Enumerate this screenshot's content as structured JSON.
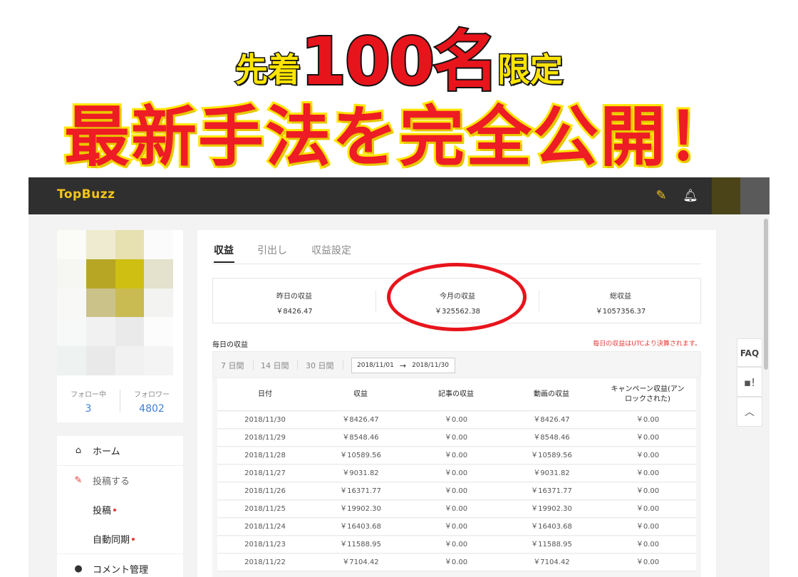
{
  "banner": {
    "line1_pre": "先着",
    "line1_big": "100名",
    "line1_post": "限定",
    "line2": "最新手法を完全公開！"
  },
  "app": {
    "logo": "TopBuzz",
    "icons": {
      "edit": "pencil-icon",
      "notifications": "bell-icon"
    }
  },
  "profile": {
    "following_label": "フォロー中",
    "following_count": "3",
    "followers_label": "フォロワー",
    "followers_count": "4802"
  },
  "nav": {
    "home": "ホーム",
    "post": "投稿する",
    "posts": "投稿",
    "auto_sync": "自動同期",
    "comments": "コメント管理"
  },
  "tabs": [
    "収益",
    "引出し",
    "収益設定"
  ],
  "summary": {
    "yesterday_label": "昨日の収益",
    "yesterday_value": "￥8426.47",
    "month_label": "今月の収益",
    "month_value": "￥325562.38",
    "total_label": "総収益",
    "total_value": "￥1057356.37"
  },
  "daily": {
    "title": "毎日の収益",
    "note": "毎日の収益はUTCより決算されます。",
    "filters": [
      "7 日間",
      "14 日間",
      "30 日間"
    ],
    "date_from": "2018/11/01",
    "date_to": "2018/11/30",
    "columns": [
      "日付",
      "収益",
      "記事の収益",
      "動画の収益",
      "キャンペーン収益(アンロックされた)"
    ],
    "rows": [
      [
        "2018/11/30",
        "￥8426.47",
        "￥0.00",
        "￥8426.47",
        "￥0.00"
      ],
      [
        "2018/11/29",
        "￥8548.46",
        "￥0.00",
        "￥8548.46",
        "￥0.00"
      ],
      [
        "2018/11/28",
        "￥10589.56",
        "￥0.00",
        "￥10589.56",
        "￥0.00"
      ],
      [
        "2018/11/27",
        "￥9031.82",
        "￥0.00",
        "￥9031.82",
        "￥0.00"
      ],
      [
        "2018/11/26",
        "￥16371.77",
        "￥0.00",
        "￥16371.77",
        "￥0.00"
      ],
      [
        "2018/11/25",
        "￥19902.30",
        "￥0.00",
        "￥19902.30",
        "￥0.00"
      ],
      [
        "2018/11/24",
        "￥16403.68",
        "￥0.00",
        "￥16403.68",
        "￥0.00"
      ],
      [
        "2018/11/23",
        "￥11588.95",
        "￥0.00",
        "￥11588.95",
        "￥0.00"
      ],
      [
        "2018/11/22",
        "￥7104.42",
        "￥0.00",
        "￥7104.42",
        "￥0.00"
      ]
    ]
  },
  "side": {
    "faq": "FAQ"
  },
  "colors": {
    "accent_yellow": "#f5c518",
    "link_blue": "#3d7ed8",
    "alert_red": "#e53935",
    "topbar": "#2f2f2f"
  }
}
